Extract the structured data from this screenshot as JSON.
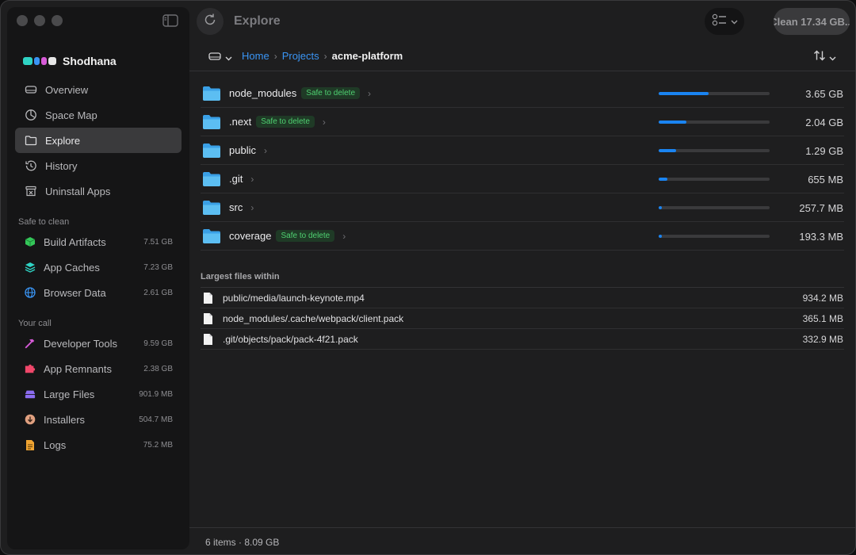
{
  "sidebar": {
    "brand_name": "Shodhana",
    "nav": [
      {
        "label": "Overview",
        "icon": "drive-icon"
      },
      {
        "label": "Space Map",
        "icon": "pie-icon"
      },
      {
        "label": "Explore",
        "icon": "folder-icon",
        "active": true
      },
      {
        "label": "History",
        "icon": "history-icon"
      },
      {
        "label": "Uninstall Apps",
        "icon": "uninstall-icon"
      }
    ],
    "safe_title": "Safe to clean",
    "safe_items": [
      {
        "label": "Build Artifacts",
        "size": "7.51 GB",
        "color": "#34c759"
      },
      {
        "label": "App Caches",
        "size": "7.23 GB",
        "color": "#2fd3c4"
      },
      {
        "label": "Browser Data",
        "size": "2.61 GB",
        "color": "#3a95f5"
      }
    ],
    "call_title": "Your call",
    "call_items": [
      {
        "label": "Developer Tools",
        "size": "9.59 GB",
        "color": "#d75bd8"
      },
      {
        "label": "App Remnants",
        "size": "2.38 GB",
        "color": "#f0476a"
      },
      {
        "label": "Large Files",
        "size": "901.9 MB",
        "color": "#8b6cf0"
      },
      {
        "label": "Installers",
        "size": "504.7 MB",
        "color": "#e0a080"
      },
      {
        "label": "Logs",
        "size": "75.2 MB",
        "color": "#f0a432"
      }
    ]
  },
  "toolbar": {
    "title": "Explore",
    "clean_label": "Clean 17.34 GB..."
  },
  "breadcrumb": {
    "home": "Home",
    "projects": "Projects",
    "current": "acme-platform"
  },
  "folders": [
    {
      "name": "node_modules",
      "badge": "Safe to delete",
      "size": "3.65 GB",
      "fill": 0.45
    },
    {
      "name": ".next",
      "badge": "Safe to delete",
      "size": "2.04 GB",
      "fill": 0.25
    },
    {
      "name": "public",
      "badge": "",
      "size": "1.29 GB",
      "fill": 0.16
    },
    {
      "name": ".git",
      "badge": "",
      "size": "655 MB",
      "fill": 0.08
    },
    {
      "name": "src",
      "badge": "",
      "size": "257.7 MB",
      "fill": 0.03
    },
    {
      "name": "coverage",
      "badge": "Safe to delete",
      "size": "193.3 MB",
      "fill": 0.025
    }
  ],
  "largest": {
    "title": "Largest files within",
    "files": [
      {
        "name": "public/media/launch-keynote.mp4",
        "size": "934.2 MB"
      },
      {
        "name": "node_modules/.cache/webpack/client.pack",
        "size": "365.1 MB"
      },
      {
        "name": ".git/objects/pack/pack-4f21.pack",
        "size": "332.9 MB"
      }
    ]
  },
  "status": {
    "summary": "6 items · 8.09 GB"
  }
}
